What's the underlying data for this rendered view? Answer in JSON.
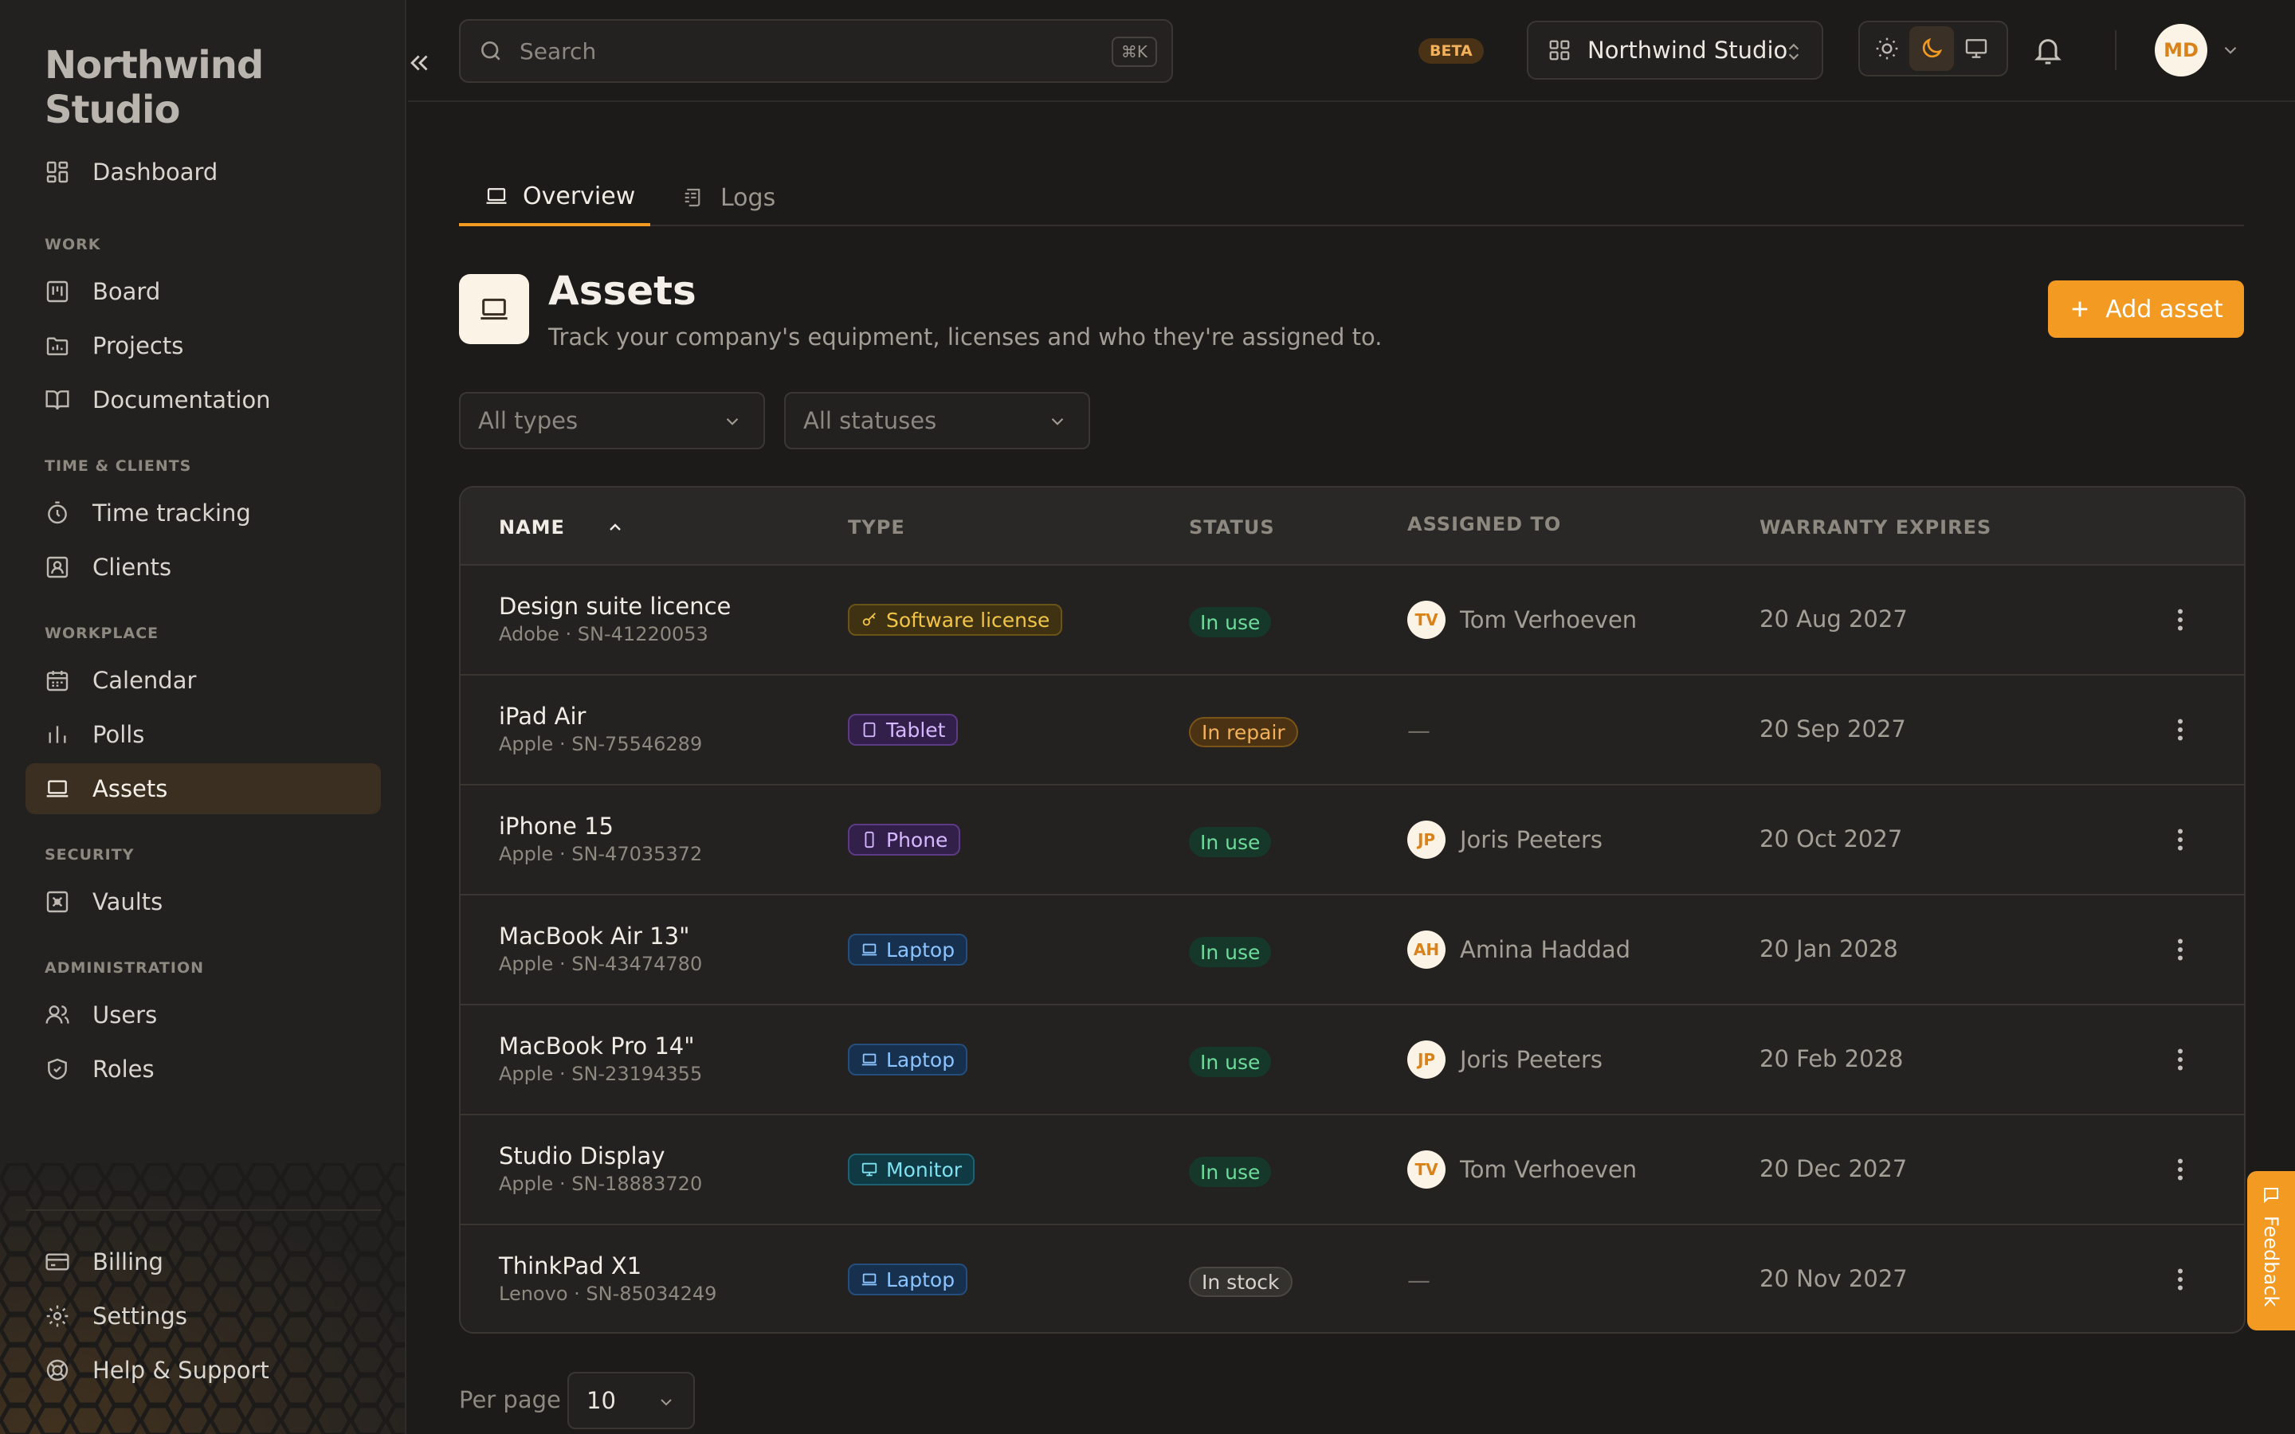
{
  "app": {
    "brand": "Northwind Studio"
  },
  "sidebar": {
    "dashboard": "Dashboard",
    "sections": {
      "work": "WORK",
      "time_clients": "TIME & CLIENTS",
      "workplace": "WORKPLACE",
      "security": "SECURITY",
      "administration": "ADMINISTRATION"
    },
    "items": {
      "board": "Board",
      "projects": "Projects",
      "documentation": "Documentation",
      "time_tracking": "Time tracking",
      "clients": "Clients",
      "calendar": "Calendar",
      "polls": "Polls",
      "assets": "Assets",
      "vaults": "Vaults",
      "users": "Users",
      "roles": "Roles"
    },
    "footer": {
      "billing": "Billing",
      "settings": "Settings",
      "help": "Help & Support"
    }
  },
  "topbar": {
    "search_placeholder": "Search",
    "search_shortcut": "⌘K",
    "beta": "BETA",
    "workspace": "Northwind Studio",
    "theme_active": "dark",
    "user_initials": "MD"
  },
  "tabs": {
    "overview": "Overview",
    "logs": "Logs"
  },
  "header": {
    "title": "Assets",
    "subtitle": "Track your company's equipment, licenses and who they're assigned to.",
    "add_button": "Add asset"
  },
  "filters": {
    "types": "All types",
    "statuses": "All statuses"
  },
  "table": {
    "columns": {
      "name": "NAME",
      "type": "TYPE",
      "status": "STATUS",
      "assigned_to": "ASSIGNED TO",
      "warranty": "WARRANTY EXPIRES"
    },
    "rows": [
      {
        "name": "Design suite licence",
        "sub": "Adobe · SN-41220053",
        "type": "Software license",
        "status": "In use",
        "initials": "TV",
        "assignee": "Tom Verhoeven",
        "warranty": "20 Aug 2027"
      },
      {
        "name": "iPad Air",
        "sub": "Apple · SN-75546289",
        "type": "Tablet",
        "status": "In repair",
        "initials": "",
        "assignee": "—",
        "warranty": "20 Sep 2027"
      },
      {
        "name": "iPhone 15",
        "sub": "Apple · SN-47035372",
        "type": "Phone",
        "status": "In use",
        "initials": "JP",
        "assignee": "Joris Peeters",
        "warranty": "20 Oct 2027"
      },
      {
        "name": "MacBook Air 13\"",
        "sub": "Apple · SN-43474780",
        "type": "Laptop",
        "status": "In use",
        "initials": "AH",
        "assignee": "Amina Haddad",
        "warranty": "20 Jan 2028"
      },
      {
        "name": "MacBook Pro 14\"",
        "sub": "Apple · SN-23194355",
        "type": "Laptop",
        "status": "In use",
        "initials": "JP",
        "assignee": "Joris Peeters",
        "warranty": "20 Feb 2028"
      },
      {
        "name": "Studio Display",
        "sub": "Apple · SN-18883720",
        "type": "Monitor",
        "status": "In use",
        "initials": "TV",
        "assignee": "Tom Verhoeven",
        "warranty": "20 Dec 2027"
      },
      {
        "name": "ThinkPad X1",
        "sub": "Lenovo · SN-85034249",
        "type": "Laptop",
        "status": "In stock",
        "initials": "",
        "assignee": "—",
        "warranty": "20 Nov 2027"
      }
    ]
  },
  "footer": {
    "per_page_label": "Per page",
    "per_page_value": "10"
  },
  "feedback": "Feedback",
  "colors": {
    "accent": "#f29a22",
    "background": "#1c1b1a",
    "sidebar": "#222120",
    "active_nav": "#3b2f22"
  }
}
